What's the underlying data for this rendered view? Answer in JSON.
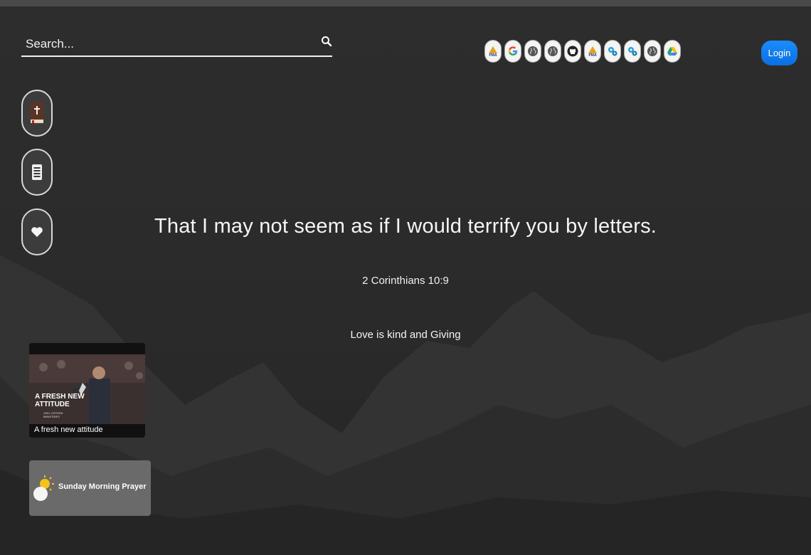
{
  "search": {
    "placeholder": "Search..."
  },
  "quicklinks": [
    {
      "name": "pma",
      "label": "PMA"
    },
    {
      "name": "google",
      "label": "G"
    },
    {
      "name": "globe",
      "label": ""
    },
    {
      "name": "globe",
      "label": ""
    },
    {
      "name": "github",
      "label": ""
    },
    {
      "name": "pma",
      "label": "PMA"
    },
    {
      "name": "gears",
      "label": ""
    },
    {
      "name": "gears",
      "label": ""
    },
    {
      "name": "globe",
      "label": ""
    },
    {
      "name": "google-drive",
      "label": ""
    }
  ],
  "header": {
    "login_label": "Login"
  },
  "side": {
    "bible_icon": "bible-icon",
    "notes_icon": "notes-icon",
    "favorites_icon": "heart-icon"
  },
  "verse": {
    "text": "That I may not seem as if I would terrify you by letters.",
    "reference": "2 Corinthians 10:9"
  },
  "tagline": "Love is kind and Giving",
  "video": {
    "thumb_title": "A FRESH NEW ATTITUDE",
    "thumb_logo": "JOEL OSTEEN MINISTRIES",
    "caption": "A fresh new attitude"
  },
  "prayer": {
    "title": "Sunday Morning Prayer"
  },
  "colors": {
    "accent": "#0b6fe0",
    "background": "#2a2a2a"
  }
}
